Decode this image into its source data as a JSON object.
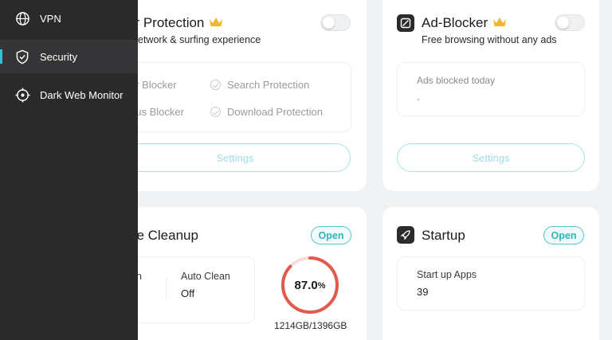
{
  "browser_protection": {
    "title": "er Protection",
    "subtitle": "etwork & surfing experience",
    "features": [
      "er Blocker",
      "Search Protection",
      "ous Blocker",
      "Download Protection"
    ],
    "settings_label": "Settings"
  },
  "ad_blocker": {
    "title": "Ad-Blocker",
    "subtitle": "Free browsing without any ads",
    "stat_label": "Ads blocked today",
    "stat_value": "-",
    "settings_label": "Settings"
  },
  "storage_cleanup": {
    "title": "ge Cleanup",
    "open_label": "Open",
    "partial_label": "n",
    "auto_clean_label": "Auto Clean",
    "auto_clean_value": "Off",
    "percent_value": "87.0",
    "percent_unit": "%",
    "percent": 87.0,
    "usage": "1214GB/1396GB"
  },
  "startup": {
    "title": "Startup",
    "open_label": "Open",
    "stat_label": "Start up Apps",
    "stat_value": "39"
  },
  "sidebar": {
    "items": [
      {
        "label": "VPN",
        "icon": "globe-icon"
      },
      {
        "label": "Security",
        "icon": "shield-icon",
        "active": true
      },
      {
        "label": "Dark Web Monitor",
        "icon": "crosshair-icon"
      }
    ]
  },
  "colors": {
    "accent": "#2fc3cb",
    "crown": "#f1b62c",
    "gauge": "#e25a4d",
    "sidebar_bg": "#2a2a2b"
  }
}
